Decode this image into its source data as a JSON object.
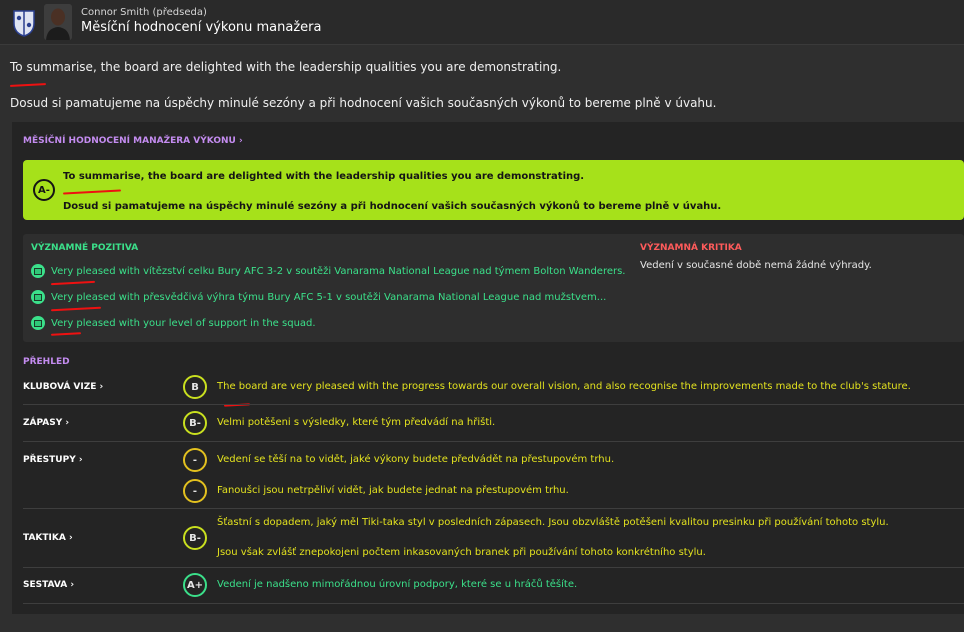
{
  "header": {
    "name": "Connor Smith",
    "role": "(předseda)",
    "title": "Měsíční hodnocení výkonu manažera"
  },
  "intro": {
    "line1": "To summarise, the board are delighted with the leadership qualities you are demonstrating.",
    "line2": "Dosud si pamatujeme na úspěchy minulé sezóny a při hodnocení vašich současných výkonů to bereme plně v úvahu."
  },
  "report": {
    "section_link": "MĚSÍČNÍ HODNOCENÍ MANAŽERA VÝKONU",
    "grade": "A-",
    "banner_line1": "To summarise, the board are delighted with the leadership qualities you are demonstrating.",
    "banner_line2": "Dosud si pamatujeme na úspěchy minulé sezóny a při hodnocení vašich současných výkonů to bereme plně v úvahu.",
    "colors": {
      "banner": "#a6e11a",
      "positive": "#3be08a",
      "negative": "#ff5b5b",
      "section": "#c48cf0"
    }
  },
  "positives": {
    "title": "VÝZNAMNÉ POZITIVA",
    "items": [
      {
        "text": "Very pleased with vítězství celku Bury AFC 3-2 v soutěži Vanarama National League nad týmem Bolton Wanderers.",
        "icon": "calendar-icon"
      },
      {
        "text": "Very pleased with přesvědčivá výhra týmu Bury AFC 5-1 v soutěži Vanarama National League nad mužstvem...",
        "icon": "calendar-icon"
      },
      {
        "text": "Very pleased with your level of support in the squad.",
        "icon": "squad-icon"
      }
    ]
  },
  "criticism": {
    "title": "VÝZNAMNÁ KRITIKA",
    "text": "Vedení v současné době nemá žádné výhrady."
  },
  "overview": {
    "title": "PŘEHLED",
    "rows": [
      {
        "label": "KLUBOVÁ VIZE",
        "grade": "B",
        "texts": [
          "The board are very pleased with the progress towards our overall vision, and also recognise the improvements made to the club's stature."
        ]
      },
      {
        "label": "ZÁPASY",
        "grade": "B-",
        "texts": [
          "Velmi potěšeni s výsledky, které tým předvádí na hřišti."
        ]
      },
      {
        "label": "PŘESTUPY",
        "grades": [
          "-",
          "-"
        ],
        "texts": [
          "Vedení se těší na to vidět, jaké výkony budete předvádět na přestupovém trhu.",
          "Fanoušci jsou netrpěliví vidět, jak budete jednat na přestupovém trhu."
        ]
      },
      {
        "label": "TAKTIKA",
        "grade": "B-",
        "texts": [
          "Šťastní s dopadem, jaký měl Tiki-taka styl v posledních zápasech. Jsou obzvláště potěšeni kvalitou presinku při používání tohoto stylu.",
          "Jsou však zvlášť znepokojeni počtem inkasovaných branek při používání tohoto konkrétního stylu."
        ]
      },
      {
        "label": "SESTAVA",
        "grade": "A+",
        "texts": [
          "Vedení je nadšeno mimořádnou úrovní podpory, které se u hráčů těšíte."
        ]
      }
    ]
  }
}
